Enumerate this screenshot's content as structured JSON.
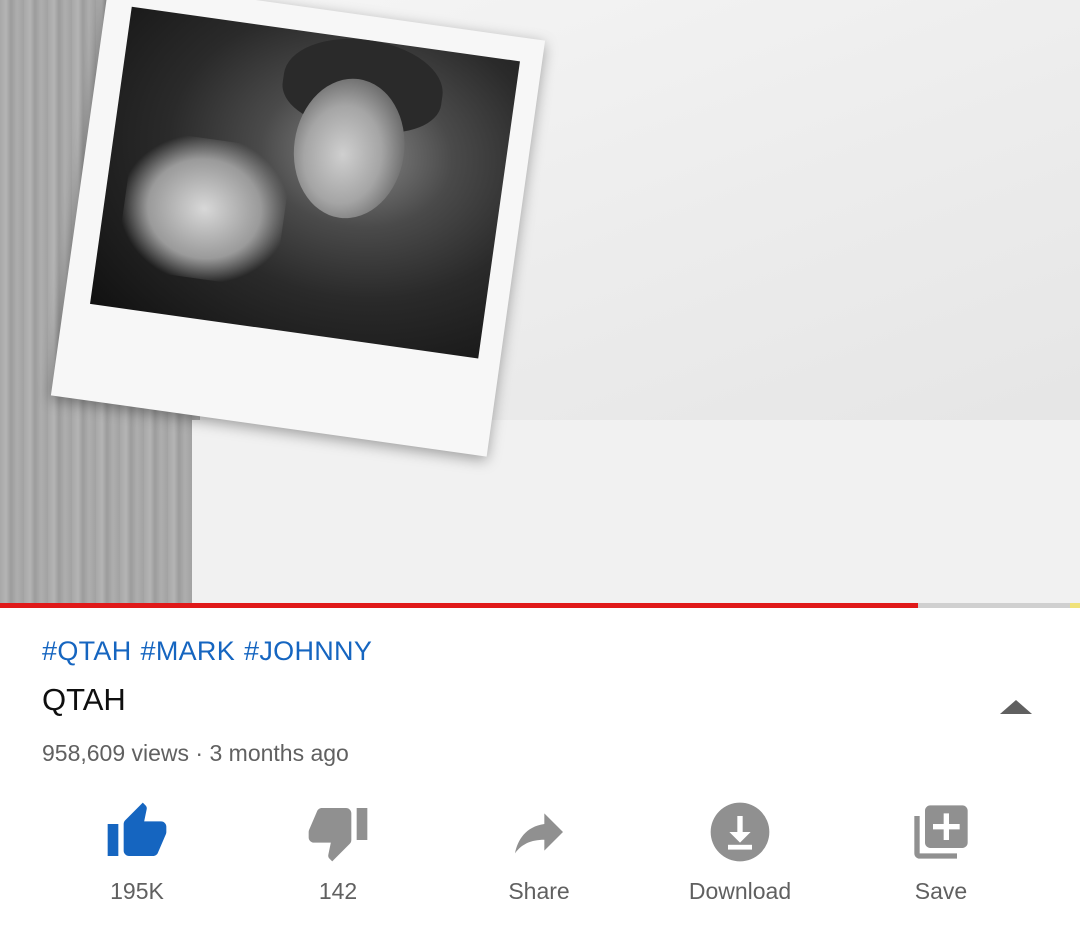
{
  "video": {
    "progress_percent": 85,
    "progress_color": "#e01919",
    "thumbnail_description_icon": "video-frame"
  },
  "info": {
    "hashtags": [
      "#QTAH",
      "#MARK",
      "#JOHNNY"
    ],
    "hashtag_color": "#1565c0",
    "title": "QTAH",
    "meta": "958,609 views · 3 months ago",
    "expand_icon": "chevron-up-icon"
  },
  "actions": [
    {
      "id": "like",
      "label": "195K",
      "icon": "thumbs-up-icon",
      "active": true,
      "color": "#1565c0"
    },
    {
      "id": "dislike",
      "label": "142",
      "icon": "thumbs-down-icon",
      "active": false,
      "color": "#909090"
    },
    {
      "id": "share",
      "label": "Share",
      "icon": "share-icon",
      "active": false,
      "color": "#909090"
    },
    {
      "id": "download",
      "label": "Download",
      "icon": "download-icon",
      "active": false,
      "color": "#909090"
    },
    {
      "id": "save",
      "label": "Save",
      "icon": "playlist-add-icon",
      "active": false,
      "color": "#909090"
    }
  ]
}
